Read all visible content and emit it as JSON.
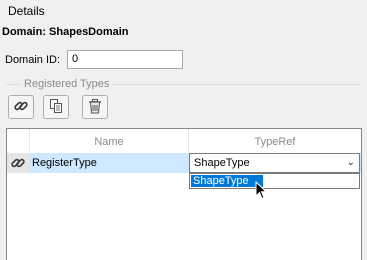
{
  "panel": {
    "group_title": "Details",
    "domain_heading": "Domain: ShapesDomain",
    "domain_id_label": "Domain ID:",
    "domain_id_value": "0"
  },
  "registered": {
    "section_label": "Registered Types",
    "toolbar": {
      "link_icon": "link-icon",
      "copy_icon": "copy-icon",
      "delete_icon": "trash-icon"
    },
    "columns": [
      "Name",
      "TypeRef"
    ],
    "rows": [
      {
        "icon": "link-icon",
        "name": "RegisterType",
        "typeref": "ShapeType"
      }
    ],
    "dropdown_options": [
      "ShapeType"
    ]
  },
  "colors": {
    "selection": "#cde8ff",
    "highlight": "#0078d7"
  }
}
